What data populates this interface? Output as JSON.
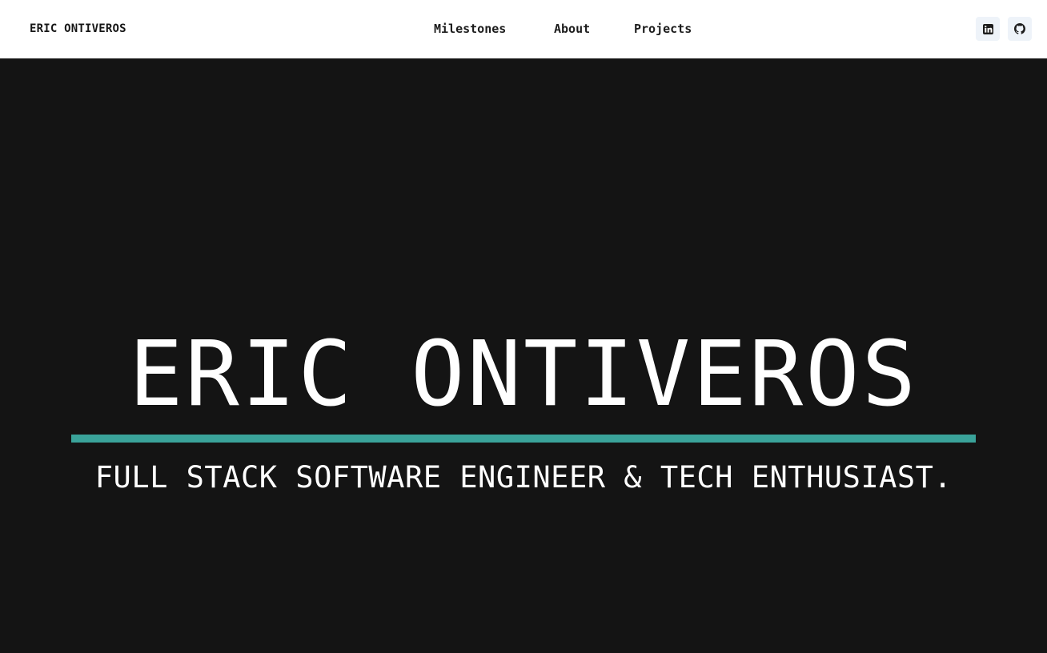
{
  "nav": {
    "brand": "ERIC ONTIVEROS",
    "links": [
      "Milestones",
      "About",
      "Projects"
    ],
    "social": [
      {
        "icon": "linkedin-icon"
      },
      {
        "icon": "github-icon"
      }
    ]
  },
  "hero": {
    "title": "ERIC ONTIVEROS",
    "subtitle": "FULL STACK SOFTWARE ENGINEER & TECH ENTHUSIAST."
  },
  "colors": {
    "background_dark": "#141414",
    "accent_rule": "#3aa39a",
    "nav_background": "#ffffff",
    "social_button_bg": "#eef3f9"
  }
}
